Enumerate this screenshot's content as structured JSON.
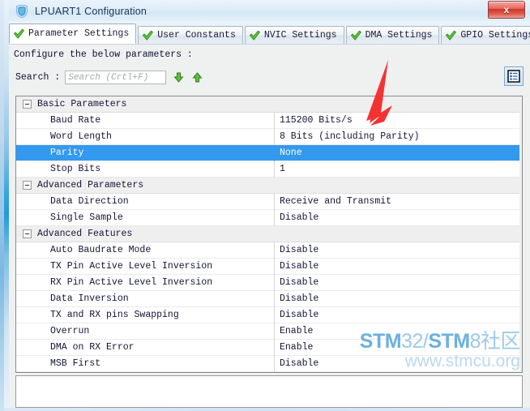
{
  "window": {
    "title": "LPUART1 Configuration",
    "icon": "shield-icon",
    "close_label": "x"
  },
  "tabs": [
    {
      "label": "Parameter Settings",
      "active": true,
      "icon": "green-check-icon"
    },
    {
      "label": "User Constants",
      "active": false,
      "icon": "green-check-icon"
    },
    {
      "label": "NVIC Settings",
      "active": false,
      "icon": "green-check-icon"
    },
    {
      "label": "DMA Settings",
      "active": false,
      "icon": "green-check-icon"
    },
    {
      "label": "GPIO Settings",
      "active": false,
      "icon": "green-check-icon"
    }
  ],
  "hint": "Configure the below parameters :",
  "search": {
    "label": "Search :",
    "value": "",
    "placeholder": "Search (Crtl+F)",
    "down_icon": "arrow-down-icon",
    "up_icon": "arrow-up-icon"
  },
  "toolbar": {
    "listview_icon": "list-view-icon"
  },
  "table": {
    "rows": [
      {
        "type": "group",
        "name": "Basic Parameters",
        "value": "",
        "selected": false
      },
      {
        "type": "item",
        "name": "Baud Rate",
        "value": "115200 Bits/s",
        "selected": false
      },
      {
        "type": "item",
        "name": "Word Length",
        "value": "8 Bits (including Parity)",
        "selected": false
      },
      {
        "type": "item",
        "name": "Parity",
        "value": "None",
        "selected": true
      },
      {
        "type": "item",
        "name": "Stop Bits",
        "value": "1",
        "selected": false
      },
      {
        "type": "group",
        "name": "Advanced Parameters",
        "value": "",
        "selected": false
      },
      {
        "type": "item",
        "name": "Data Direction",
        "value": "Receive and Transmit",
        "selected": false
      },
      {
        "type": "item",
        "name": "Single Sample",
        "value": "Disable",
        "selected": false
      },
      {
        "type": "group",
        "name": "Advanced Features",
        "value": "",
        "selected": false
      },
      {
        "type": "item",
        "name": "Auto Baudrate Mode",
        "value": "Disable",
        "selected": false
      },
      {
        "type": "item",
        "name": "TX Pin Active Level Inversion",
        "value": "Disable",
        "selected": false
      },
      {
        "type": "item",
        "name": "RX Pin Active Level Inversion",
        "value": "Disable",
        "selected": false
      },
      {
        "type": "item",
        "name": "Data Inversion",
        "value": "Disable",
        "selected": false
      },
      {
        "type": "item",
        "name": "TX and RX pins Swapping",
        "value": "Disable",
        "selected": false
      },
      {
        "type": "item",
        "name": "Overrun",
        "value": "Enable",
        "selected": false
      },
      {
        "type": "item",
        "name": "DMA on RX Error",
        "value": "Enable",
        "selected": false
      },
      {
        "type": "item",
        "name": "MSB First",
        "value": "Disable",
        "selected": false
      }
    ]
  },
  "watermark": {
    "line1_a": "STM",
    "line1_b": "32/",
    "line1_c": "STM",
    "line1_d": "8社区",
    "line2": "www.stmcu.org"
  },
  "annotation": {
    "type": "red-arrow",
    "color": "#f53232"
  },
  "colors": {
    "selection": "#3399ee",
    "group_header": "#efefef",
    "annotation_red": "#f53232",
    "title_text": "#17365d"
  }
}
